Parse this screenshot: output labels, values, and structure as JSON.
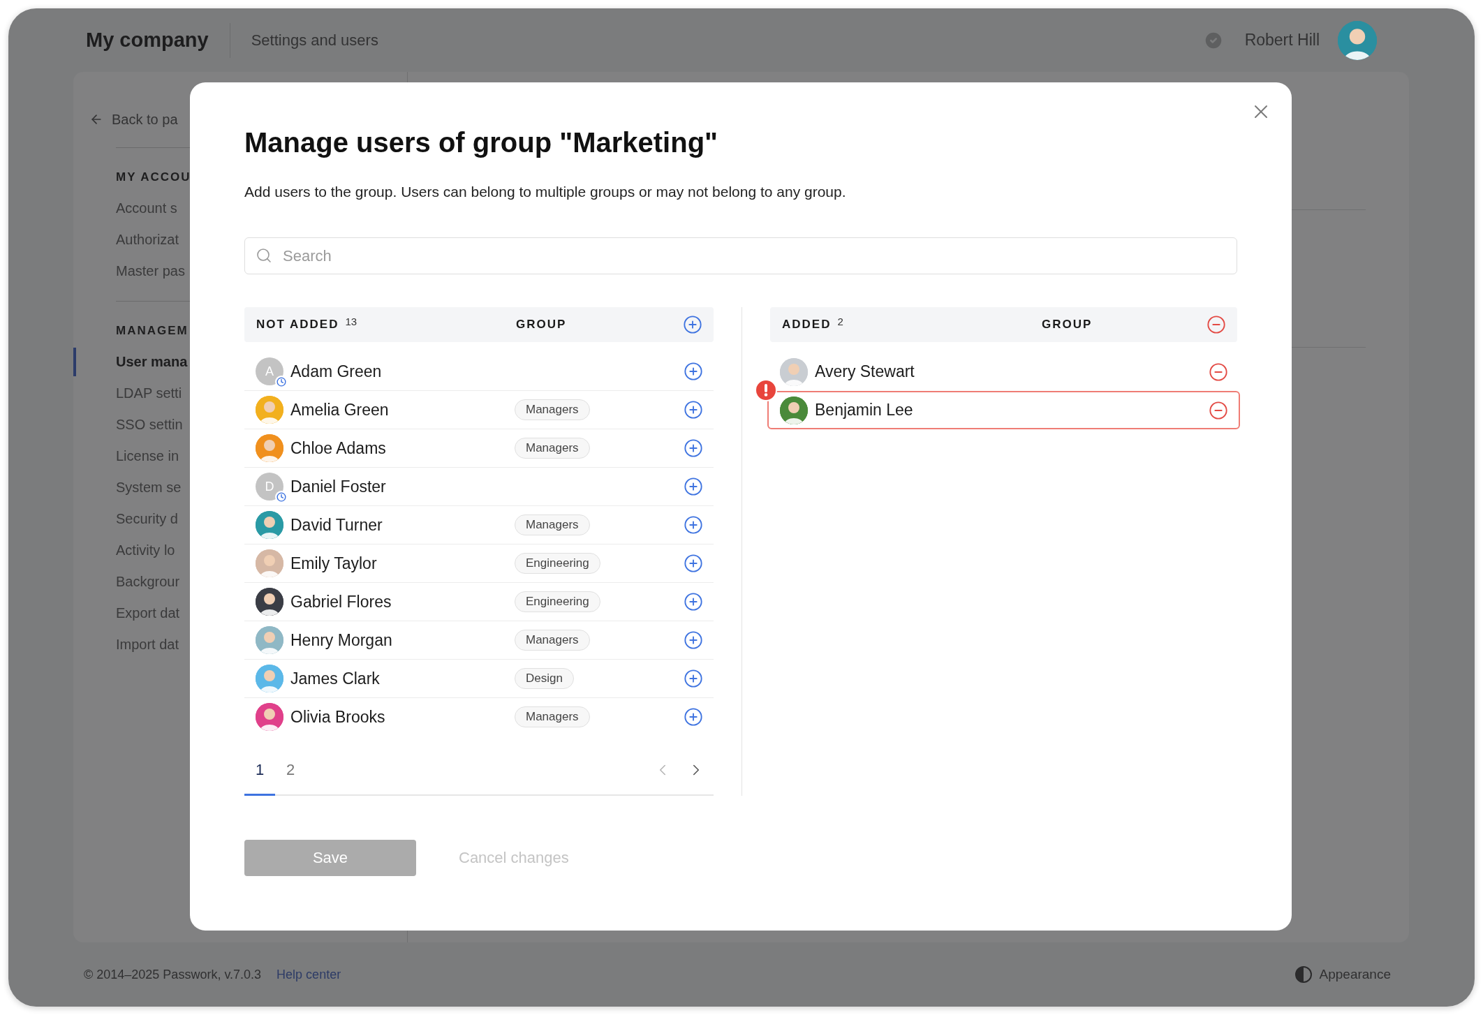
{
  "app_header": {
    "company": "My company",
    "section": "Settings and users",
    "user_name": "Robert Hill",
    "user_avatar": {
      "kind": "photo",
      "color": "#2a8fa0"
    }
  },
  "sidebar": {
    "back_link": "Back to pa",
    "sections": [
      {
        "heading": "MY ACCOU",
        "items": [
          {
            "label": "Account s",
            "selected": false
          },
          {
            "label": "Authorizat",
            "selected": false
          },
          {
            "label": "Master pas",
            "selected": false
          }
        ]
      },
      {
        "heading": "MANAGEM",
        "items": [
          {
            "label": "User mana",
            "selected": true
          },
          {
            "label": "LDAP setti",
            "selected": false
          },
          {
            "label": "SSO settin",
            "selected": false
          },
          {
            "label": "License in",
            "selected": false
          },
          {
            "label": "System se",
            "selected": false
          },
          {
            "label": "Security d",
            "selected": false
          },
          {
            "label": "Activity lo",
            "selected": false
          },
          {
            "label": "Backgrour",
            "selected": false
          },
          {
            "label": "Export dat",
            "selected": false
          },
          {
            "label": "Import dat",
            "selected": false
          }
        ]
      }
    ]
  },
  "dialog": {
    "title": "Manage users of group \"Marketing\"",
    "description": "Add users to the group. Users can belong to multiple groups or may not belong to any group.",
    "search": {
      "placeholder": "Search"
    },
    "not_added": {
      "heading": "NOT ADDED",
      "count": "13",
      "group_heading": "GROUP",
      "users": [
        {
          "name": "Adam Green",
          "avatar": {
            "kind": "initials",
            "text": "A"
          },
          "pending": true
        },
        {
          "name": "Amelia Green",
          "group": "Managers",
          "avatar": {
            "kind": "photo",
            "color": "#f2b01e"
          },
          "pending": false
        },
        {
          "name": "Chloe Adams",
          "group": "Managers",
          "avatar": {
            "kind": "photo",
            "color": "#f0901e"
          },
          "pending": false
        },
        {
          "name": "Daniel Foster",
          "avatar": {
            "kind": "initials",
            "text": "D"
          },
          "pending": true
        },
        {
          "name": "David Turner",
          "group": "Managers",
          "avatar": {
            "kind": "photo",
            "color": "#2a9aa5"
          },
          "pending": false
        },
        {
          "name": "Emily Taylor",
          "group": "Engineering",
          "avatar": {
            "kind": "photo",
            "color": "#d6b8a5"
          },
          "pending": false
        },
        {
          "name": "Gabriel Flores",
          "group": "Engineering",
          "avatar": {
            "kind": "photo",
            "color": "#3a3d45"
          },
          "pending": false
        },
        {
          "name": "Henry Morgan",
          "group": "Managers",
          "avatar": {
            "kind": "photo",
            "color": "#8fb8c5"
          },
          "pending": false
        },
        {
          "name": "James Clark",
          "group": "Design",
          "avatar": {
            "kind": "photo",
            "color": "#5bb8e8"
          },
          "pending": false
        },
        {
          "name": "Olivia Brooks",
          "group": "Managers",
          "avatar": {
            "kind": "photo",
            "color": "#e0408a"
          },
          "pending": false
        }
      ],
      "pages": [
        {
          "label": "1",
          "selected": true
        },
        {
          "label": "2",
          "selected": false
        }
      ]
    },
    "added": {
      "heading": "ADDED",
      "count": "2",
      "group_heading": "GROUP",
      "users": [
        {
          "name": "Avery Stewart",
          "avatar": {
            "kind": "photo",
            "color": "#c9cdd2"
          },
          "error": false
        },
        {
          "name": "Benjamin Lee",
          "avatar": {
            "kind": "photo",
            "color": "#4a8a3a"
          },
          "error": true
        }
      ]
    },
    "buttons": [
      {
        "kind": "primary",
        "label": "Save",
        "disabled": true
      },
      {
        "kind": "link",
        "label": "Cancel changes",
        "disabled": true
      }
    ]
  },
  "footer": {
    "copyright": "© 2014–2025 Passwork, v.7.0.3",
    "help_link": "Help center",
    "appearance": "Appearance"
  }
}
